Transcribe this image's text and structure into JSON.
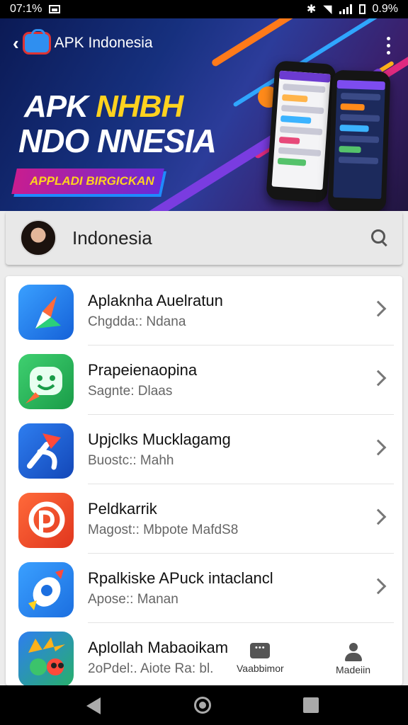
{
  "status_bar": {
    "left_text": "07:1%",
    "right_text": "0.9%"
  },
  "header": {
    "back_symbol": "‹",
    "app_title": "APK Indonesia"
  },
  "banner": {
    "headline_line1_a": "APK ",
    "headline_line1_b": "NHBH",
    "headline_line2": "NDO NNESIA",
    "tagline": "APPLADI BIRGICKAN",
    "accent_color": "#ffd21f"
  },
  "search": {
    "text": "Indonesia",
    "icon": "search-icon"
  },
  "apps": [
    {
      "title": "Aplaknha Auelratun",
      "subtitle": "Chgdda:: Ndana",
      "icon": "compass-icon"
    },
    {
      "title": "Prapeienaopina",
      "subtitle": "Sagnte: Dlaas",
      "icon": "smiley-icon"
    },
    {
      "title": "Upjclks Mucklagamg",
      "subtitle": "Buostc:: Mahh",
      "icon": "arrow-icon"
    },
    {
      "title": "Peldkarrik",
      "subtitle": "Magost:: Mbpote MafdS8",
      "icon": "p-icon"
    },
    {
      "title": "Rpalkiske APuck intaclancl",
      "subtitle": "Apose:: Manan",
      "icon": "rocket-icon"
    },
    {
      "title": "Aplollah Mabaoikam",
      "subtitle": "2oPdel:. Aiote Ra: bl.",
      "icon": "monster-icon"
    }
  ],
  "bottom_nav": [
    {
      "label": "Vaabbimor",
      "icon": "chat-icon"
    },
    {
      "label": "Madeiin",
      "icon": "person-icon"
    }
  ],
  "system_nav": {
    "back": "back-icon",
    "home": "home-icon",
    "recents": "recents-icon"
  }
}
